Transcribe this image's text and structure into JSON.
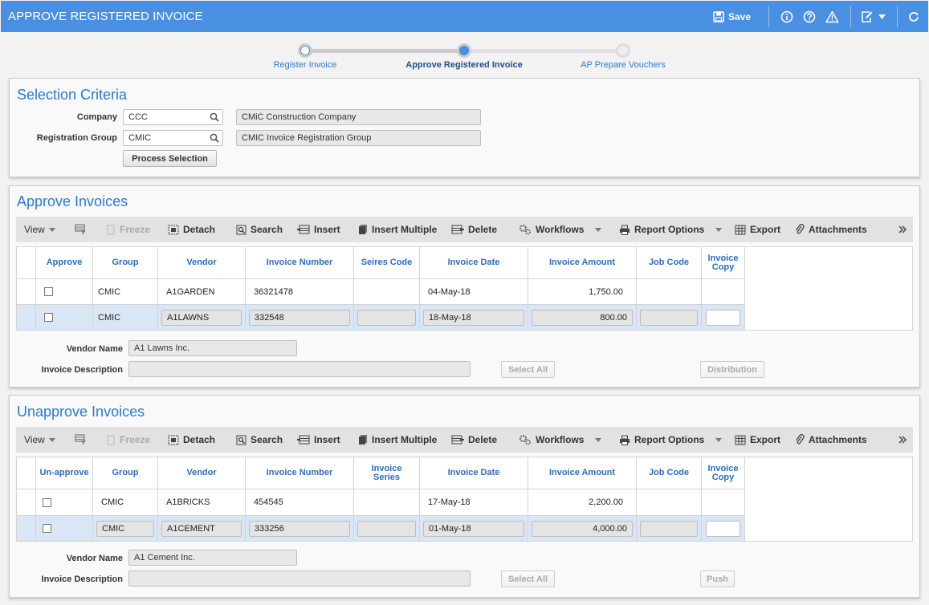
{
  "header": {
    "title": "APPROVE REGISTERED INVOICE",
    "save_label": "Save"
  },
  "steps": [
    {
      "label": "Register Invoice",
      "state": "done"
    },
    {
      "label": "Approve Registered Invoice",
      "state": "current"
    },
    {
      "label": "AP Prepare Vouchers",
      "state": "todo"
    }
  ],
  "selection": {
    "title": "Selection Criteria",
    "company_label": "Company",
    "company_value": "CCC",
    "company_desc": "CMiC Construction Company",
    "group_label": "Registration Group",
    "group_value": "CMIC",
    "group_desc": "CMIC Invoice Registration Group",
    "process_button": "Process Selection"
  },
  "approve": {
    "title": "Approve Invoices",
    "toolbar": {
      "view": "View",
      "freeze": "Freeze",
      "detach": "Detach",
      "search": "Search",
      "insert": "Insert",
      "insert_multiple": "Insert Multiple",
      "delete": "Delete",
      "workflows": "Workflows",
      "report_options": "Report Options",
      "export": "Export",
      "attachments": "Attachments"
    },
    "columns": [
      "Approve",
      "Group",
      "Vendor",
      "Invoice Number",
      "Seires Code",
      "Invoice Date",
      "Invoice Amount",
      "Job Code",
      "Invoice Copy"
    ],
    "rows": [
      {
        "group": "CMIC",
        "vendor": "A1GARDEN",
        "number": "36321478",
        "series": "",
        "date": "04-May-18",
        "amount": "1,750.00",
        "job": ""
      },
      {
        "group": "CMIC",
        "vendor": "A1LAWNS",
        "number": "332548",
        "series": "",
        "date": "18-May-18",
        "amount": "800.00",
        "job": ""
      }
    ],
    "vendor_name_label": "Vendor Name",
    "vendor_name_value": "A1 Lawns Inc.",
    "invoice_desc_label": "Invoice Description",
    "invoice_desc_value": "",
    "select_all": "Select All",
    "action_button": "Distribution"
  },
  "unapprove": {
    "title": "Unapprove Invoices",
    "toolbar": {
      "view": "View",
      "freeze": "Freeze",
      "detach": "Detach",
      "search": "Search",
      "insert": "Insert",
      "insert_multiple": "Insert Multiple",
      "delete": "Delete",
      "workflows": "Workflows",
      "report_options": "Report Options",
      "export": "Export",
      "attachments": "Attachments"
    },
    "columns": [
      "Un-approve",
      "Group",
      "Vendor",
      "Invoice Number",
      "Invoice Series",
      "Invoice Date",
      "Invoice Amount",
      "Job Code",
      "Invoice Copy"
    ],
    "rows": [
      {
        "group": "CMIC",
        "vendor": "A1BRICKS",
        "number": "454545",
        "series": "",
        "date": "17-May-18",
        "amount": "2,200.00",
        "job": ""
      },
      {
        "group": "CMIC",
        "vendor": "A1CEMENT",
        "number": "333256",
        "series": "",
        "date": "01-May-18",
        "amount": "4,000.00",
        "job": ""
      }
    ],
    "vendor_name_label": "Vendor Name",
    "vendor_name_value": "A1 Cement Inc.",
    "invoice_desc_label": "Invoice Description",
    "invoice_desc_value": "",
    "select_all": "Select All",
    "action_button": "Push"
  }
}
